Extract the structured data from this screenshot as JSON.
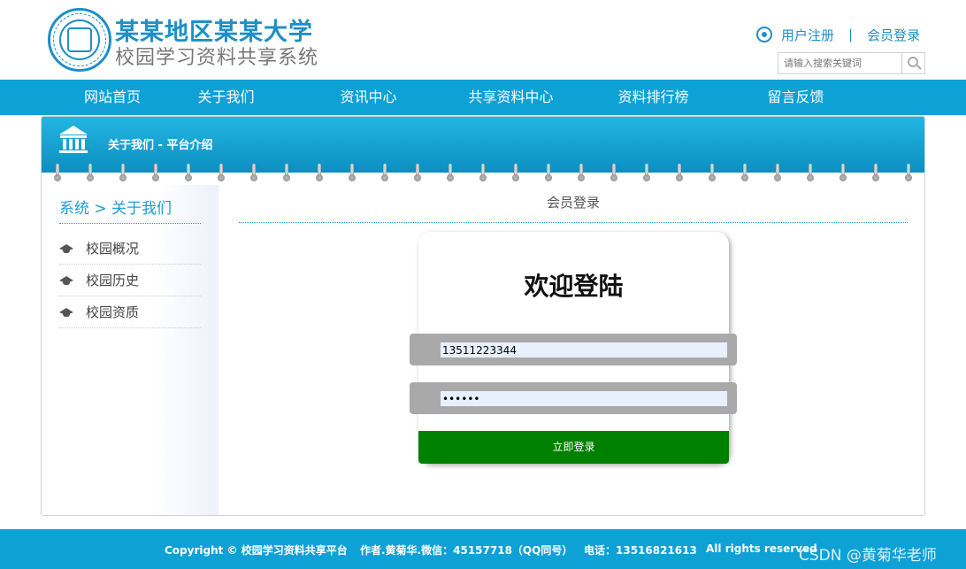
{
  "header": {
    "title": "某某地区某某大学",
    "subtitle": "校园学习资料共享系统",
    "links": {
      "register": "用户注册",
      "separator": "|",
      "login": "会员登录"
    },
    "search": {
      "placeholder": "请输入搜索关键词"
    },
    "brand_color": "#1e8fc7"
  },
  "nav": {
    "items": [
      "网站首页",
      "关于我们",
      "资讯中心",
      "共享资料中心",
      "资料排行榜",
      "留言反馈"
    ],
    "bg_color": "#0ea1d6"
  },
  "banner": {
    "text": "关于我们 - 平台介绍"
  },
  "sidebar": {
    "title": "系统 > 关于我们",
    "items": [
      "校园概况",
      "校园历史",
      "校园资质"
    ]
  },
  "content": {
    "title": "会员登录",
    "login": {
      "heading": "欢迎登陆",
      "username_value": "13511223344",
      "password_value": "••••••",
      "submit_label": "立即登录",
      "button_color": "#008000"
    }
  },
  "footer": {
    "copyright": "Copyright © 校园学习资料共享平台",
    "author": "作者.黄菊华.微信：45157718（QQ同号）",
    "phone": "电话：13516821613",
    "rights": "All rights reserved",
    "watermark": "CSDN @黄菊华老师"
  }
}
